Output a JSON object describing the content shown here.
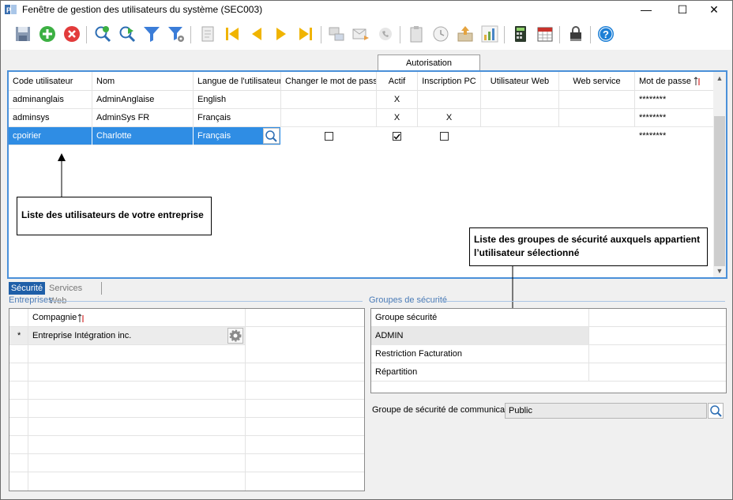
{
  "window": {
    "title": "Fenêtre de gestion des utilisateurs du système (SEC003)"
  },
  "title_buttons": {
    "minimize": "—",
    "maximize": "☐",
    "close": "✕"
  },
  "toolbar": {
    "buttons": [
      "save-icon",
      "add-icon",
      "delete-icon",
      "search-add-icon",
      "search-go-icon",
      "filter-icon",
      "filter-settings-icon",
      "report-icon",
      "first-record-icon",
      "previous-record-icon",
      "next-record-icon",
      "last-record-icon",
      "workflow-icon",
      "email-icon",
      "phone-icon",
      "clipboard-icon",
      "history-icon",
      "export-icon",
      "chart-icon",
      "calculator-icon",
      "calendar-icon",
      "lock-icon",
      "help-icon"
    ]
  },
  "upper_grid": {
    "group_header": "Autorisation",
    "columns": [
      "Code utilisateur",
      "Nom",
      "Langue de l'utilisateur",
      "Changer le mot de passe",
      "Actif",
      "Inscription  PC",
      "Utilisateur Web",
      "Web service",
      "Mot de passe"
    ],
    "rows": [
      {
        "code": "adminanglais",
        "name": "AdminAnglaise",
        "language": "English",
        "change_pw": "",
        "active": "X",
        "pc": "",
        "web_user": "",
        "web_service": "",
        "password": "********"
      },
      {
        "code": "adminsys",
        "name": "AdminSys FR",
        "language": "Français",
        "change_pw": "",
        "active": "X",
        "pc": "X",
        "web_user": "",
        "web_service": "",
        "password": "********"
      },
      {
        "code": "cpoirier",
        "name": "Charlotte",
        "language": "Français",
        "change_pw": false,
        "active": true,
        "pc": false,
        "web_user": "",
        "web_service": "",
        "password": "********"
      }
    ]
  },
  "callouts": {
    "users": "Liste des utilisateurs de votre entreprise",
    "groups": "Liste des groupes de sécurité auxquels appartient l’utilisateur sélectionné"
  },
  "lower_tabs": {
    "security": "Sécurité",
    "web_services": "Services Web"
  },
  "companies": {
    "section_label": "Entreprises",
    "column": "Compagnie",
    "rows": [
      {
        "marker": "*",
        "name": "Entreprise Intégration inc."
      }
    ]
  },
  "security_groups": {
    "section_label": "Groupes de sécurité",
    "column": "Groupe sécurité",
    "rows": [
      "ADMIN",
      "Restriction Facturation",
      "Répartition"
    ],
    "comm_label": "Groupe de sécurité de communication",
    "comm_value": "Public"
  },
  "colors": {
    "selection": "#2f8de4",
    "border_accent": "#4a90d9",
    "tab_active": "#1f5fa8"
  }
}
